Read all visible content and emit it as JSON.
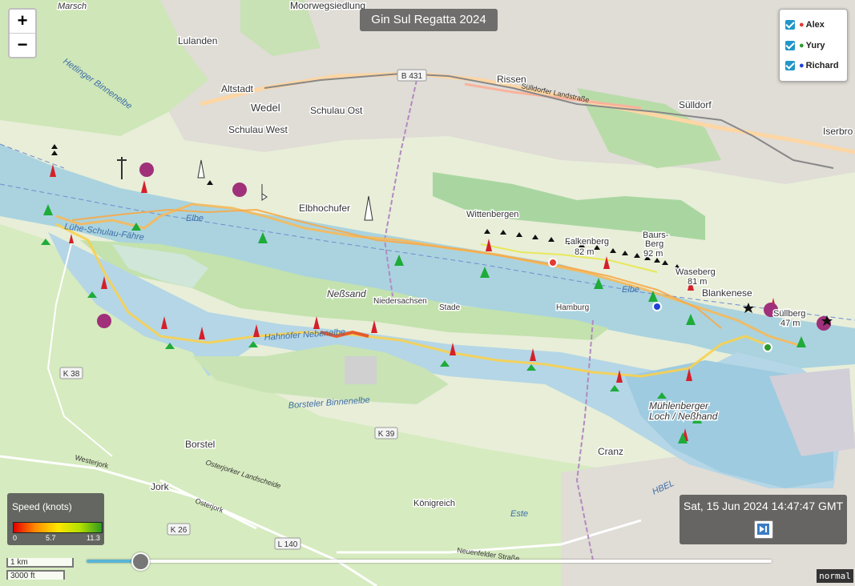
{
  "app": {
    "title": "Gin Sul Regatta 2024"
  },
  "zoom": {
    "in_label": "+",
    "out_label": "−"
  },
  "legend": {
    "items": [
      {
        "name": "Alex",
        "dot_color": "#e53935",
        "checked": true
      },
      {
        "name": "Yury",
        "dot_color": "#2e9a2e",
        "checked": true
      },
      {
        "name": "Richard",
        "dot_color": "#1e40d8",
        "checked": true
      }
    ]
  },
  "speed_legend": {
    "title": "Speed (knots)",
    "ticks": [
      "0",
      "5.7",
      "11.3"
    ],
    "colors": [
      "#e50000",
      "#ff8c00",
      "#ffe600",
      "#b4e000",
      "#2f9a1f"
    ]
  },
  "timestamp": "Sat, 15 Jun 2024 14:47:47 GMT",
  "playback": {
    "progress": 0.077,
    "icon": "play-pause-icon"
  },
  "scale": {
    "metric": "1 km",
    "imperial": "3000 ft"
  },
  "mode": "normal",
  "map_labels": {
    "marsch": "Marsch",
    "moorwegsiedlung": "Moorwegsiedlung",
    "lulanden": "Lulanden",
    "altstadt": "Altstadt",
    "wedel": "Wedel",
    "schulau_ost": "Schulau Ost",
    "schulau_west": "Schulau West",
    "rissen": "Rissen",
    "sulldorf": "Sülldorf",
    "iserbrook": "Iserbro",
    "elbhochufer": "Elbhochufer",
    "wittenbergen": "Wittenbergen",
    "falkenberg": "Falkenberg",
    "falkenberg_h": "82 m",
    "baursberg": "Baurs-",
    "baursberg2": "Berg",
    "baursberg_h": "92 m",
    "waseberg": "Waseberg",
    "waseberg_h": "81 m",
    "blankenese": "Blankenese",
    "suellberg": "Süllberg",
    "suellberg_h": "47 m",
    "nessand": "Neßsand",
    "niedersachsen": "Niedersachsen",
    "hamburg": "Hamburg",
    "stade": "Stade",
    "lühe": "Lühe-Schulau-Fähre",
    "hetlinger": "Hetlinger Binnenelbe",
    "elbe": "Elbe",
    "hahnöfer": "Hahnöfer Nebenelbe",
    "muehlenberger": "Mühlenberger",
    "muehlenberger2": "Loch / Neßhand",
    "borsteler": "Borsteler Binnenelbe",
    "borstel": "Borstel",
    "jork": "Jork",
    "cranz": "Cranz",
    "koenigreich": "Königreich",
    "este": "Este",
    "k38": "K 38",
    "k39": "K 39",
    "k26": "K 26",
    "l140": "L 140",
    "b431": "B 431",
    "sulldorfer_landstrasse": "Sülldorfer Landstraße",
    "westerjork": "Westerjork",
    "osterjork": "Osterjork",
    "osterjorker_landscheide": "Osterjorker Landscheide",
    "neuenfelder": "Neuenfelder Straße",
    "hbel": "HBEL"
  }
}
